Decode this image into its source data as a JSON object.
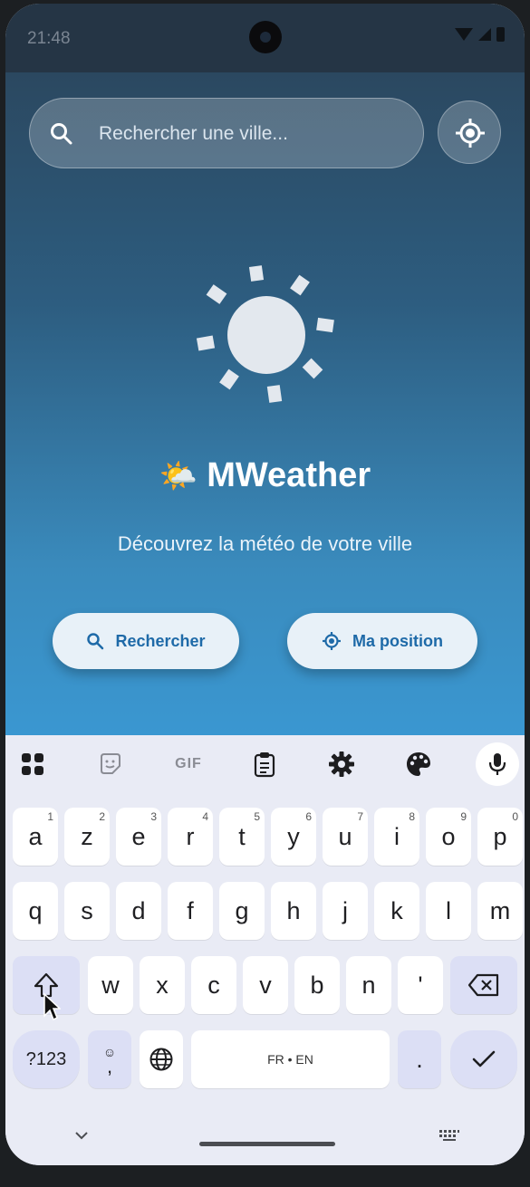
{
  "status_bar": {
    "time": "21:48"
  },
  "search": {
    "placeholder": "Rechercher une ville..."
  },
  "app": {
    "title": "MWeather",
    "title_emoji": "🌤️",
    "tagline": "Découvrez la météo de votre ville",
    "search_button_label": "Rechercher",
    "position_button_label": "Ma position",
    "accent_color": "#1e6aa8"
  },
  "keyboard": {
    "toolbar_gif_label": "GIF",
    "row1": [
      {
        "letter": "a",
        "num": "1"
      },
      {
        "letter": "z",
        "num": "2"
      },
      {
        "letter": "e",
        "num": "3"
      },
      {
        "letter": "r",
        "num": "4"
      },
      {
        "letter": "t",
        "num": "5"
      },
      {
        "letter": "y",
        "num": "6"
      },
      {
        "letter": "u",
        "num": "7"
      },
      {
        "letter": "i",
        "num": "8"
      },
      {
        "letter": "o",
        "num": "9"
      },
      {
        "letter": "p",
        "num": "0"
      }
    ],
    "row2": [
      "q",
      "s",
      "d",
      "f",
      "g",
      "h",
      "j",
      "k",
      "l",
      "m"
    ],
    "row3": [
      "w",
      "x",
      "c",
      "v",
      "b",
      "n",
      "'"
    ],
    "symbols_label": "?123",
    "emoji_comma_label": ",",
    "space_label": "FR • EN",
    "period_label": "."
  }
}
